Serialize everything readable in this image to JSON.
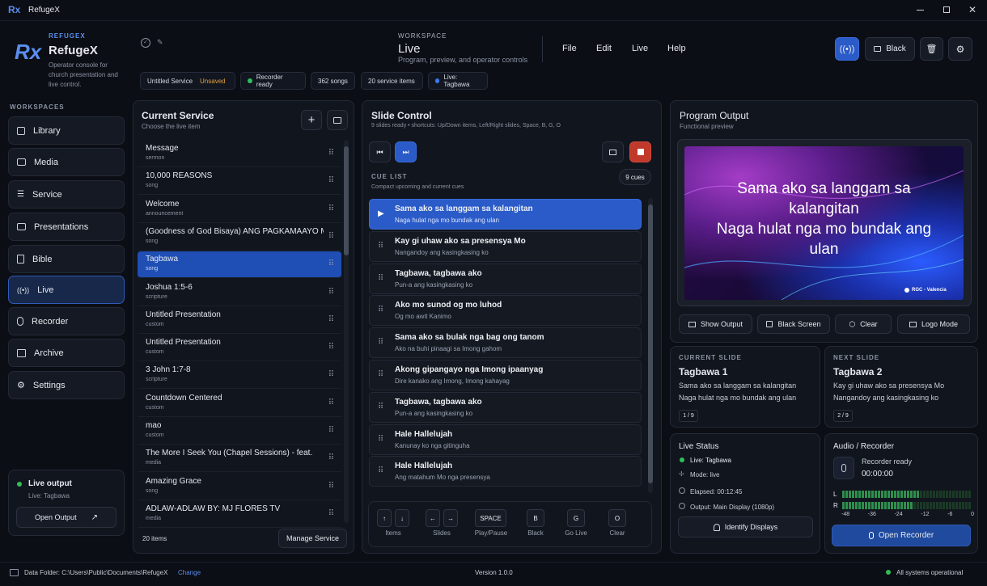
{
  "titlebar": {
    "title": "RefugeX"
  },
  "brand": {
    "eyebrow": "REFUGEX",
    "name": "RefugeX",
    "tagline": "Operator console for church presentation and live control."
  },
  "workspace": {
    "eyebrow": "WORKSPACE",
    "title": "Live",
    "subtitle": "Program, preview, and operator controls"
  },
  "menu": {
    "file": "File",
    "edit": "Edit",
    "live": "Live",
    "help": "Help"
  },
  "toolbar": {
    "black_label": "Black"
  },
  "chips": {
    "service": "Untitled Service",
    "unsaved": "Unsaved",
    "recorder": "Recorder ready",
    "songs": "362 songs",
    "items": "20 service items",
    "live": "Live: Tagbawa"
  },
  "sidebar": {
    "heading": "WORKSPACES",
    "items": [
      {
        "label": "Library",
        "icon": "library-icon"
      },
      {
        "label": "Media",
        "icon": "image-icon"
      },
      {
        "label": "Service",
        "icon": "list-icon"
      },
      {
        "label": "Presentations",
        "icon": "presentation-icon"
      },
      {
        "label": "Bible",
        "icon": "book-icon"
      },
      {
        "label": "Live",
        "icon": "broadcast-icon"
      },
      {
        "label": "Recorder",
        "icon": "microphone-icon"
      },
      {
        "label": "Archive",
        "icon": "archive-icon"
      },
      {
        "label": "Settings",
        "icon": "gear-icon"
      }
    ],
    "live_output": {
      "title": "Live output",
      "subtitle": "Live: Tagbawa",
      "button": "Open Output"
    }
  },
  "service": {
    "title": "Current Service",
    "subtitle": "Choose the live item",
    "items": [
      {
        "title": "Message",
        "type": "sermon"
      },
      {
        "title": "10,000 REASONS",
        "type": "song"
      },
      {
        "title": "Welcome",
        "type": "announcement"
      },
      {
        "title": "(Goodness of God Bisaya) ANG PAGKAMAAYO MO",
        "type": "song"
      },
      {
        "title": "Tagbawa",
        "type": "song"
      },
      {
        "title": "Joshua 1:5-6",
        "type": "scripture"
      },
      {
        "title": "Untitled Presentation",
        "type": "custom"
      },
      {
        "title": "Untitled Presentation",
        "type": "custom"
      },
      {
        "title": "3 John 1:7-8",
        "type": "scripture"
      },
      {
        "title": "Countdown Centered",
        "type": "custom"
      },
      {
        "title": "mao",
        "type": "custom"
      },
      {
        "title": "The More I Seek You (Chapel Sessions) - feat.",
        "type": "media"
      },
      {
        "title": "Amazing Grace",
        "type": "song"
      },
      {
        "title": "ADLAW-ADLAW BY: MJ FLORES TV",
        "type": "media"
      }
    ],
    "count": "20 items",
    "manage_button": "Manage Service"
  },
  "slide_control": {
    "title": "Slide Control",
    "subtitle": "9 slides ready • shortcuts: Up/Down items, Left/Right slides, Space, B, G, O",
    "cue_heading": "CUE LIST",
    "cue_sub": "Compact upcoming and current cues",
    "cue_count": "9 cues",
    "cues": [
      {
        "title": "Sama ako sa langgam sa kalangitan",
        "sub": "Naga hulat nga mo bundak ang ulan"
      },
      {
        "title": "Kay gi uhaw ako sa presensya Mo",
        "sub": "Nangandoy ang kasingkasing ko"
      },
      {
        "title": "Tagbawa, tagbawa ako",
        "sub": "Pun-a ang kasingkasing ko"
      },
      {
        "title": "Ako mo sunod og mo luhod",
        "sub": "Og mo awit Kanimo"
      },
      {
        "title": "Sama ako sa bulak nga bag ong tanom",
        "sub": "Ako na buhi pinaagi sa Imong gahom"
      },
      {
        "title": "Akong gipangayo nga Imong ipaanyag",
        "sub": "Dire kanako ang Imong, Imong kahayag"
      },
      {
        "title": "Tagbawa, tagbawa ako",
        "sub": "Pun-a ang kasingkasing ko"
      },
      {
        "title": "Hale Hallelujah",
        "sub": "Kanunay ko nga gitinguha"
      },
      {
        "title": "Hale Hallelujah",
        "sub": "Ang matahum Mo nga presensya"
      }
    ],
    "shortcuts": {
      "items": "Items",
      "slides": "Slides",
      "space_key": "SPACE",
      "space": "Play/Pause",
      "b_key": "B",
      "b": "Black",
      "g_key": "G",
      "g": "Go Live",
      "o_key": "O",
      "o": "Clear"
    }
  },
  "program": {
    "title": "Program Output",
    "subtitle": "Functional preview",
    "line1": "Sama ako sa langgam sa",
    "line2": "kalangitan",
    "line3": "Naga hulat nga mo bundak ang",
    "line4": "ulan",
    "watermark": "RGC - Valencia",
    "buttons": {
      "show": "Show Output",
      "black": "Black Screen",
      "clear": "Clear",
      "logo": "Logo Mode"
    }
  },
  "current_slide": {
    "eyebrow": "CURRENT SLIDE",
    "title": "Tagbawa 1",
    "line1": "Sama ako sa langgam sa kalangitan",
    "line2": "Naga hulat nga mo bundak ang ulan",
    "page": "1 / 9"
  },
  "next_slide": {
    "eyebrow": "NEXT SLIDE",
    "title": "Tagbawa 2",
    "line1": "Kay gi uhaw ako sa presensya Mo",
    "line2": "Nangandoy ang kasingkasing ko",
    "page": "2 / 9"
  },
  "live_status": {
    "title": "Live Status",
    "live": "Live: Tagbawa",
    "mode": "Mode: live",
    "elapsed": "Elapsed: 00:12:45",
    "output": "Output: Main Display (1080p)",
    "identify": "Identify Displays"
  },
  "audio": {
    "title": "Audio / Recorder",
    "status": "Recorder ready",
    "time": "00:00:00",
    "left": "L",
    "right": "R",
    "scale": [
      "-48",
      "-36",
      "-24",
      "-12",
      "-6",
      "0"
    ],
    "open_button": "Open Recorder",
    "level_left": 0.6,
    "level_right": 0.55
  },
  "footer": {
    "folder": "Data Folder: C:\\Users\\Public\\Documents\\RefugeX",
    "change": "Change",
    "version": "Version 1.0.0",
    "status": "All systems operational"
  },
  "colors": {
    "accent": "#2a5bc8",
    "live_green": "#2fbf5a",
    "stop_red": "#c0392b"
  }
}
